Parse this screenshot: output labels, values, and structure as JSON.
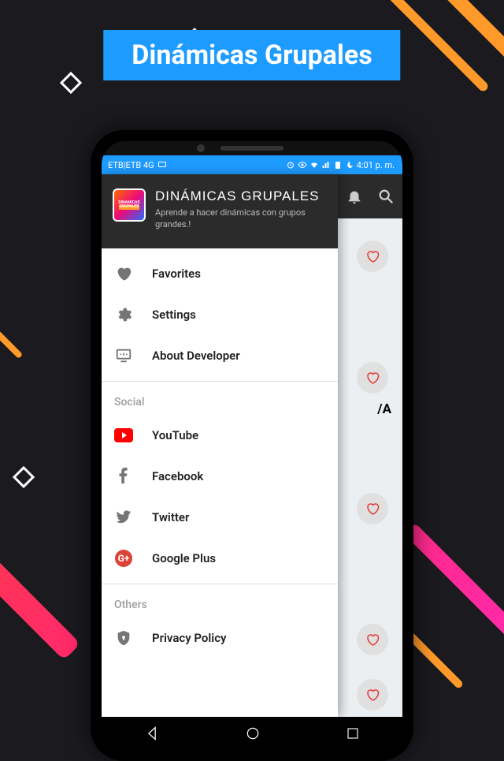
{
  "banner": {
    "title": "Dinámicas Grupales"
  },
  "statusbar": {
    "carrier": "ETB|ETB 4G",
    "time": "4:01 p. m."
  },
  "drawer": {
    "title": "DINÁMICAS GRUPALES",
    "subtitle": "Aprende a hacer dinámicas con grupos grandes.!",
    "items": {
      "favorites": "Favorites",
      "settings": "Settings",
      "about": "About Developer"
    },
    "social_header": "Social",
    "social": {
      "youtube": "YouTube",
      "facebook": "Facebook",
      "twitter": "Twitter",
      "gplus": "Google Plus"
    },
    "others_header": "Others",
    "others": {
      "privacy": "Privacy Policy"
    }
  },
  "appicon": {
    "line1": "DINAMICAS",
    "line2": "GRUPALES"
  }
}
